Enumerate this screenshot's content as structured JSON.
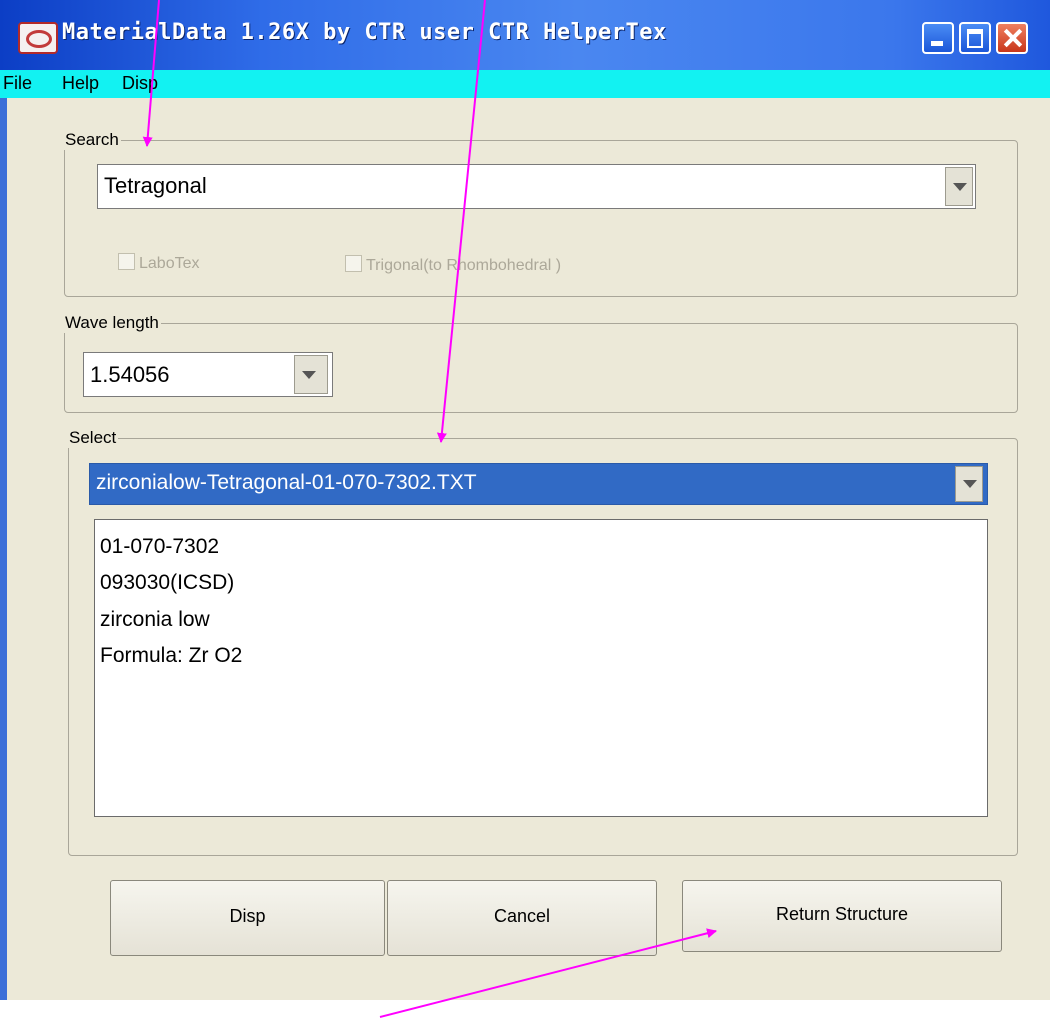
{
  "window": {
    "title": "MaterialData 1.26X by CTR user CTR HelperTex"
  },
  "menu": {
    "file": "File",
    "help": "Help",
    "disp": "Disp"
  },
  "search": {
    "legend": "Search",
    "value": "Tetragonal",
    "labotex_label": "LaboTex",
    "trigonal_label": "Trigonal(to Rhombohedral )"
  },
  "wavelength": {
    "legend": "Wave length",
    "value": "1.54056"
  },
  "select": {
    "legend": "Select",
    "file_value": "zirconialow-Tetragonal-01-070-7302.TXT",
    "details": [
      "01-070-7302",
      "093030(ICSD)",
      "zirconia low",
      "Formula: Zr O2"
    ]
  },
  "buttons": {
    "disp": "Disp",
    "cancel": "Cancel",
    "return_structure": "Return Structure"
  },
  "colors": {
    "annotation_arrow": "#ff00ff",
    "selection": "#316ac5",
    "menubar": "#12f2f2"
  },
  "icons": {
    "app": "material-data-app-icon",
    "dropdown": "chevron-down-icon",
    "minimize": "minimize-icon",
    "maximize": "maximize-icon",
    "close": "close-icon"
  }
}
